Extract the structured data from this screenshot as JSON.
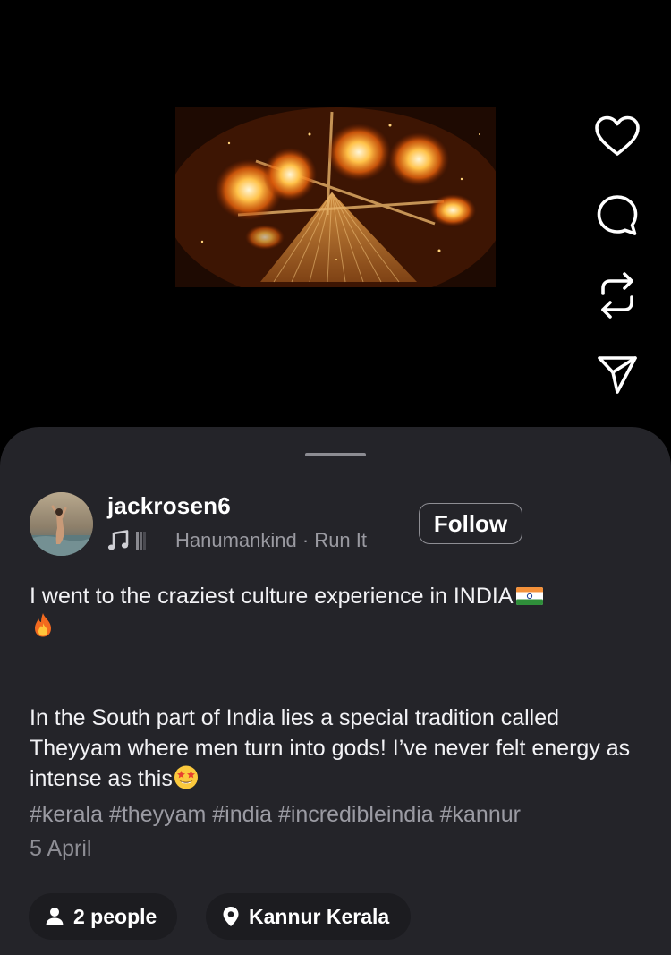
{
  "post": {
    "username": "jackrosen6",
    "track": "Hanumankind · Run It",
    "follow_label": "Follow",
    "caption_line1": "I went to the craziest culture experience in INDIA",
    "caption_para2": "In the South part of India lies a special tradition called Theyyam where men turn into gods! I’ve never felt energy as intense as this",
    "hashtags": "#kerala #theyyam #india #incredibleindia #kannur",
    "date": "5 April",
    "people_label": "2 people",
    "location_label": "Kannur Kerala"
  },
  "actions": {
    "like_icon": "heart-icon",
    "comment_icon": "comment-bubble-icon",
    "repost_icon": "repost-icon",
    "share_icon": "send-icon"
  },
  "colors": {
    "background": "#000000",
    "sheet": "#242429",
    "chip": "#1c1c20",
    "muted_text": "#9b9ba3",
    "fire": "#ff9a1f"
  }
}
